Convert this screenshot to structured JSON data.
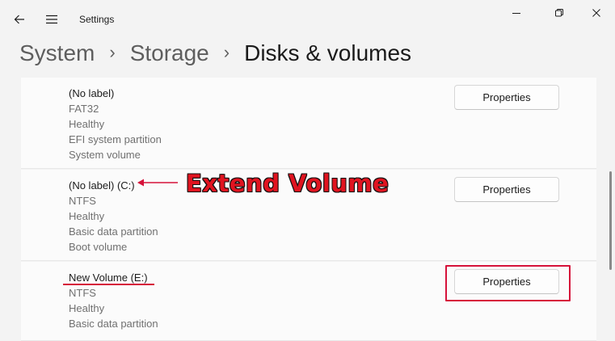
{
  "app": {
    "title": "Settings"
  },
  "breadcrumb": [
    "System",
    "Storage",
    "Disks & volumes"
  ],
  "volumes": [
    {
      "name": "(No label)",
      "details": [
        "FAT32",
        "Healthy",
        "EFI system partition",
        "System volume"
      ],
      "button": "Properties"
    },
    {
      "name": "(No label) (C:)",
      "details": [
        "NTFS",
        "Healthy",
        "Basic data partition",
        "Boot volume"
      ],
      "button": "Properties"
    },
    {
      "name": "New Volume (E:)",
      "details": [
        "NTFS",
        "Healthy",
        "Basic data partition"
      ],
      "button": "Properties"
    }
  ],
  "annotation": {
    "label": "Extend Volume",
    "color": "#e01420"
  },
  "colors": {
    "background": "#f3f3f3",
    "card": "#fbfbfb",
    "annotation": "#d6123a"
  }
}
